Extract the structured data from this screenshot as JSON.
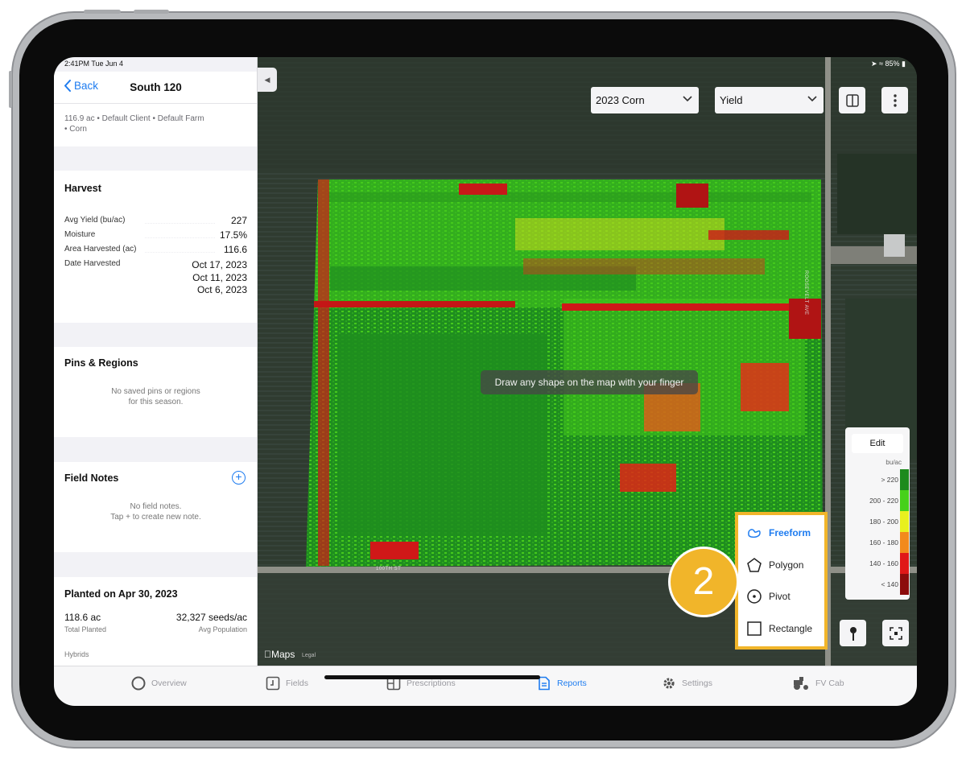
{
  "status": {
    "time": "2:41PM  Tue Jun 4",
    "battery": "85%"
  },
  "nav": {
    "back_label": "Back",
    "title": "South 120"
  },
  "field_meta": {
    "line1": "116.9 ac • Default Client • Default Farm",
    "line2": "• Corn"
  },
  "harvest": {
    "title": "Harvest",
    "rows": [
      {
        "label": "Avg Yield (bu/ac)",
        "value": "227"
      },
      {
        "label": "Moisture",
        "value": "17.5%"
      },
      {
        "label": "Area Harvested (ac)",
        "value": "116.6"
      },
      {
        "label": "Date Harvested",
        "value": ""
      }
    ],
    "dates": [
      "Oct 17, 2023",
      "Oct 11, 2023",
      "Oct 6, 2023"
    ]
  },
  "pins": {
    "title": "Pins & Regions",
    "empty_line1": "No saved pins or regions",
    "empty_line2": "for this season."
  },
  "notes": {
    "title": "Field Notes",
    "add_label": "+",
    "empty_line1": "No field notes.",
    "empty_line2": "Tap + to create new note."
  },
  "planted": {
    "title": "Planted on Apr 30, 2023",
    "total_value": "118.6 ac",
    "total_label": "Total Planted",
    "pop_value": "32,327 seeds/ac",
    "pop_label": "Avg Population",
    "hybrids_label": "Hybrids"
  },
  "map": {
    "season_select": "2023 Corn",
    "layer_select": "Yield",
    "toast": "Draw any shape on the map with your finger",
    "maps_logo": "Maps",
    "maps_legal": "Legal",
    "road_south": "100TH ST",
    "road_east": "ROOSEVELT AVE",
    "step_number": "2"
  },
  "legend": {
    "edit_label": "Edit",
    "unit": "bu/ac",
    "items": [
      {
        "label": "> 220",
        "color": "#1d8a1d"
      },
      {
        "label": "200 - 220",
        "color": "#46d11a"
      },
      {
        "label": "180 - 200",
        "color": "#e8f01e"
      },
      {
        "label": "160 - 180",
        "color": "#f28a1c"
      },
      {
        "label": "140 - 160",
        "color": "#e01818"
      },
      {
        "label": "< 140",
        "color": "#8c0c0c"
      }
    ]
  },
  "draw_tools": [
    {
      "label": "Freeform",
      "icon": "freeform-icon",
      "active": true
    },
    {
      "label": "Polygon",
      "icon": "polygon-icon",
      "active": false
    },
    {
      "label": "Pivot",
      "icon": "pivot-icon",
      "active": false
    },
    {
      "label": "Rectangle",
      "icon": "rectangle-icon",
      "active": false
    }
  ],
  "tabs": [
    {
      "label": "Overview",
      "icon": "overview-icon"
    },
    {
      "label": "Fields",
      "icon": "fields-icon"
    },
    {
      "label": "Prescriptions",
      "icon": "prescriptions-icon"
    },
    {
      "label": "Reports",
      "icon": "reports-icon",
      "active": true
    },
    {
      "label": "Settings",
      "icon": "gear-icon"
    },
    {
      "label": "FV Cab",
      "icon": "tractor-icon"
    }
  ],
  "colors": {
    "accent": "#1e7cf0",
    "highlight": "#f1b52a"
  }
}
